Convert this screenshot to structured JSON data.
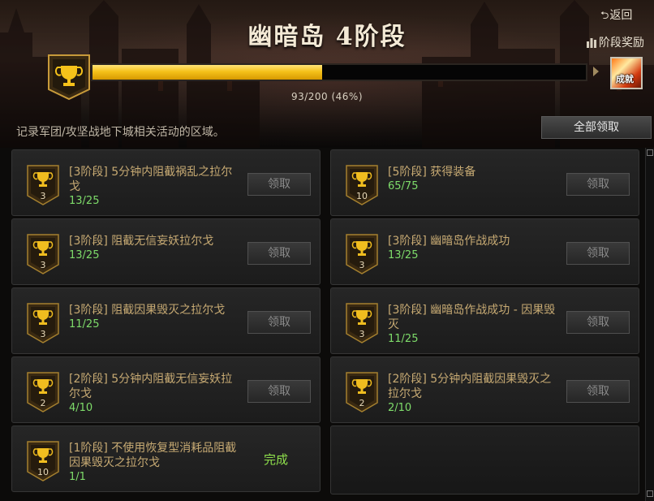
{
  "header": {
    "title": "幽暗岛 4阶段",
    "back_label": "返回",
    "stage_reward_label": "阶段奖励",
    "progress_text": "93/200 (46%)",
    "progress_fraction": 0.46,
    "reward_item_label": "成就"
  },
  "description": "记录军团/攻坚战地下城相关活动的区域。",
  "claim_all_label": "全部领取",
  "achievements": [
    {
      "name": "[3阶段] 5分钟内阻截祸乱之拉尔戈",
      "count": "13/25",
      "badge": "3",
      "action": "领取"
    },
    {
      "name": "[5阶段] 获得装备",
      "count": "65/75",
      "badge": "10",
      "action": "领取"
    },
    {
      "name": "[3阶段] 阻截无信妄妖拉尔戈",
      "count": "13/25",
      "badge": "3",
      "action": "领取"
    },
    {
      "name": "[3阶段] 幽暗岛作战成功",
      "count": "13/25",
      "badge": "3",
      "action": "领取"
    },
    {
      "name": "[3阶段] 阻截因果毁灭之拉尔戈",
      "count": "11/25",
      "badge": "3",
      "action": "领取"
    },
    {
      "name": "[3阶段] 幽暗岛作战成功 - 因果毁灭",
      "count": "11/25",
      "badge": "3",
      "action": "领取"
    },
    {
      "name": "[2阶段] 5分钟内阻截无信妄妖拉尔戈",
      "count": "4/10",
      "badge": "2",
      "action": "领取"
    },
    {
      "name": "[2阶段] 5分钟内阻截因果毁灭之拉尔戈",
      "count": "2/10",
      "badge": "2",
      "action": "领取"
    },
    {
      "name": "[1阶段] 不使用恢复型消耗品阻截因果毁灭之拉尔戈",
      "count": "1/1",
      "badge": "10",
      "status": "完成"
    }
  ],
  "colors": {
    "progress_fill": "#f5c21a",
    "achievement_name": "#c7aa73",
    "count": "#7edc6a",
    "done": "#8fe04c"
  }
}
